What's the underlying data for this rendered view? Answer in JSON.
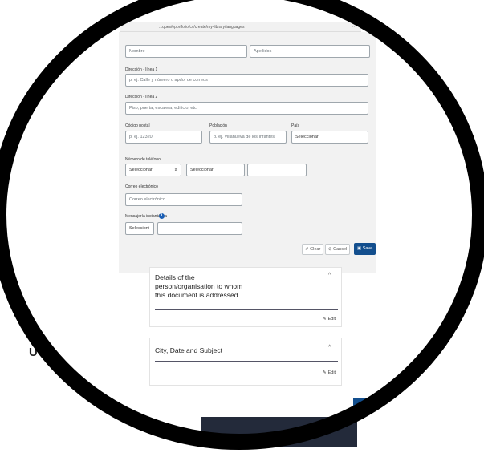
{
  "browser": {
    "url": "...ques/eportfolio/cv/create/my-library/languages",
    "menu_dots": "···"
  },
  "form": {
    "nombre_placeholder": "Nombre",
    "apellidos_placeholder": "Apellidos",
    "direccion1_label": "Dirección - línea 1",
    "direccion1_placeholder": "p. ej. Calle y número o apdo. de correos",
    "direccion2_label": "Dirección - línea 2",
    "direccion2_placeholder": "Piso, puerta, escalera, edificio, etc.",
    "codigo_postal_label": "Código postal",
    "codigo_postal_placeholder": "p. ej. 12320",
    "poblacion_label": "Población",
    "poblacion_placeholder": "p. ej. Villanueva de los Infantes",
    "pais_label": "País",
    "pais_value": "Seleccionar",
    "telefono_label": "Número de teléfono",
    "telefono_type": "Seleccionar",
    "telefono_prefix": "Seleccionar",
    "telefono_number": "",
    "correo_label": "Correo electrónico",
    "correo_placeholder": "Correo electrónico",
    "mensajeria_label": "Mensajería instantánea",
    "mensajeria_select": "Seleccion",
    "mensajeria_value": ""
  },
  "actions": {
    "clear": "Clear",
    "cancel": "Cancel",
    "save": "Save"
  },
  "cards": [
    {
      "title": "Details of the person/organisation to whom this document is addressed.",
      "edit": "Edit"
    },
    {
      "title": "City, Date and Subject",
      "edit": "Edit"
    }
  ],
  "side_glyph": "U",
  "colors": {
    "primary": "#134f8e",
    "panel": "#f2f2f2",
    "border": "#9fa7ad"
  }
}
